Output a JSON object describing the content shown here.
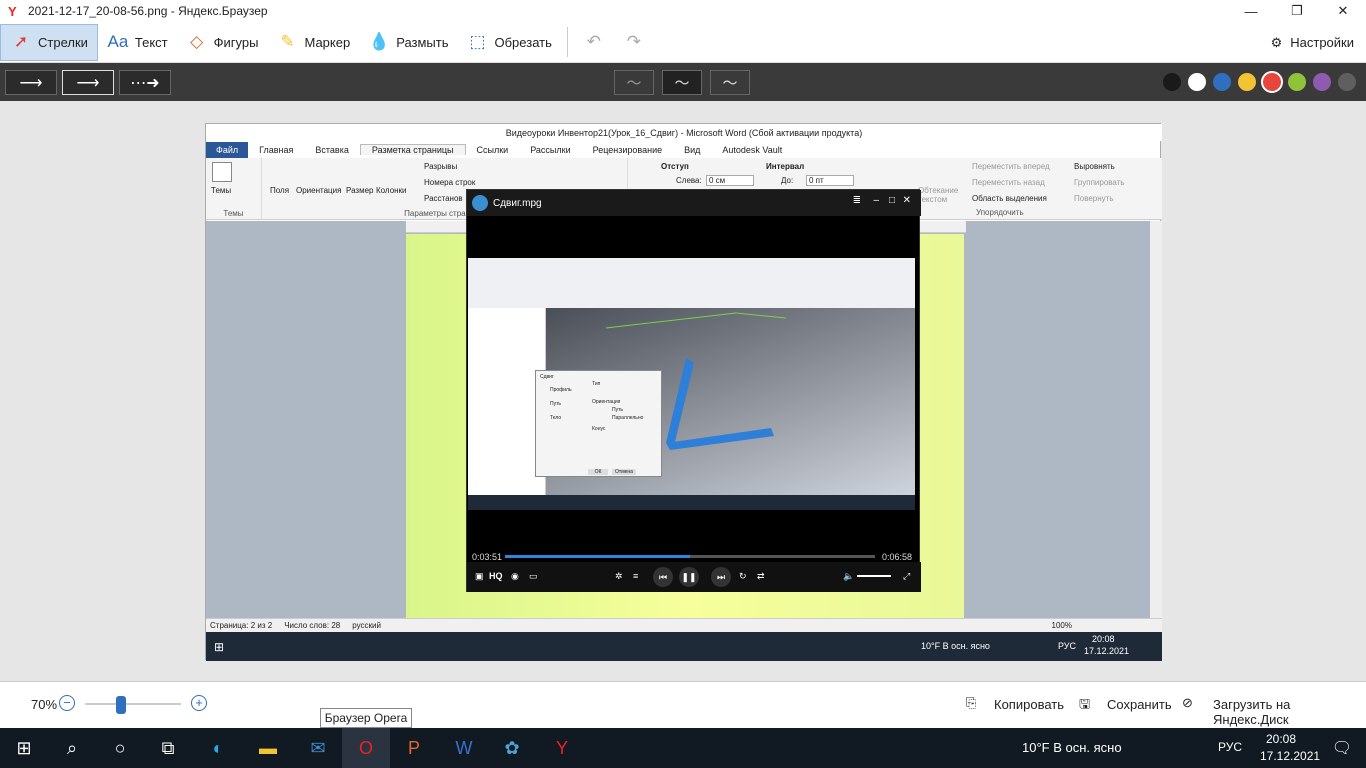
{
  "window": {
    "title": "2021-12-17_20-08-56.png - Яндекс.Браузер",
    "logo": "Y"
  },
  "toolbar": {
    "tools": [
      {
        "label": "Стрелки",
        "icon": "arrow-icon"
      },
      {
        "label": "Текст",
        "icon": "text-icon"
      },
      {
        "label": "Фигуры",
        "icon": "shapes-icon"
      },
      {
        "label": "Маркер",
        "icon": "marker-icon"
      },
      {
        "label": "Размыть",
        "icon": "blur-icon"
      },
      {
        "label": "Обрезать",
        "icon": "crop-icon"
      }
    ],
    "settings_label": "Настройки"
  },
  "colors": [
    "#1a1a1a",
    "#ffffff",
    "#2f6fbf",
    "#f3c332",
    "#e8453c",
    "#8fc43a",
    "#8e5bb0",
    "#5f5f5f"
  ],
  "word": {
    "title": "Видеоуроки Инвентор21(Урок_16_Сдвиг) - Microsoft Word (Сбой активации продукта)",
    "tabs": [
      "Файл",
      "Главная",
      "Вставка",
      "Разметка страницы",
      "Ссылки",
      "Рассылки",
      "Рецензирование",
      "Вид",
      "Autodesk Vault"
    ],
    "ribbon": {
      "themes": "Темы",
      "themes_group": "Темы",
      "fields": "Поля",
      "orientation": "Ориентация",
      "size": "Размер",
      "columns": "Колонки",
      "breaks": "Разрывы",
      "line_numbers": "Номера строк",
      "hyphenation": "Расстанов",
      "page_setup_group": "Параметры страницы",
      "indent": "Отступ",
      "indent_left": "Слева:",
      "indent_val": "0 см",
      "spacing": "Интервал",
      "spacing_before": "До:",
      "spacing_val": "0 пт",
      "wrap": "Обтекание текстом",
      "forward": "Переместить вперед",
      "backward": "Переместить назад",
      "selection": "Область выделения",
      "align": "Выровнять",
      "group": "Группировать",
      "rotate": "Повернуть",
      "arrange_group": "Упорядочить"
    },
    "status": {
      "page": "Страница: 2 из 2",
      "words": "Число слов: 28",
      "lang": "русский",
      "zoom": "100%"
    },
    "taskbar": {
      "weather": "10°F  В осн. ясно",
      "lang": "РУС",
      "time": "20:08",
      "date": "17.12.2021"
    }
  },
  "player": {
    "title": "Сдвиг.mpg",
    "time_current": "0:03:51",
    "time_total": "0:06:58",
    "progress": 0.5,
    "hq": "HQ",
    "dialog": {
      "title": "Сдвиг",
      "profile": "Профиль",
      "path": "Путь",
      "solid": "Тело",
      "type": "Тип",
      "orientation": "Ориентация",
      "path_opt": "Путь",
      "parallel": "Параллельно",
      "taper": "Конус",
      "ok": "ОК",
      "cancel": "Отмена"
    }
  },
  "bottom": {
    "zoom": "70%",
    "zoom_level": 0.36,
    "copy": "Копировать",
    "save": "Сохранить",
    "upload": "Загрузить на Яндекс.Диск"
  },
  "tooltip": "Браузер Opera",
  "taskbar": {
    "weather": "10°F  В осн. ясно",
    "lang": "РУС",
    "time": "20:08",
    "date": "17.12.2021"
  }
}
